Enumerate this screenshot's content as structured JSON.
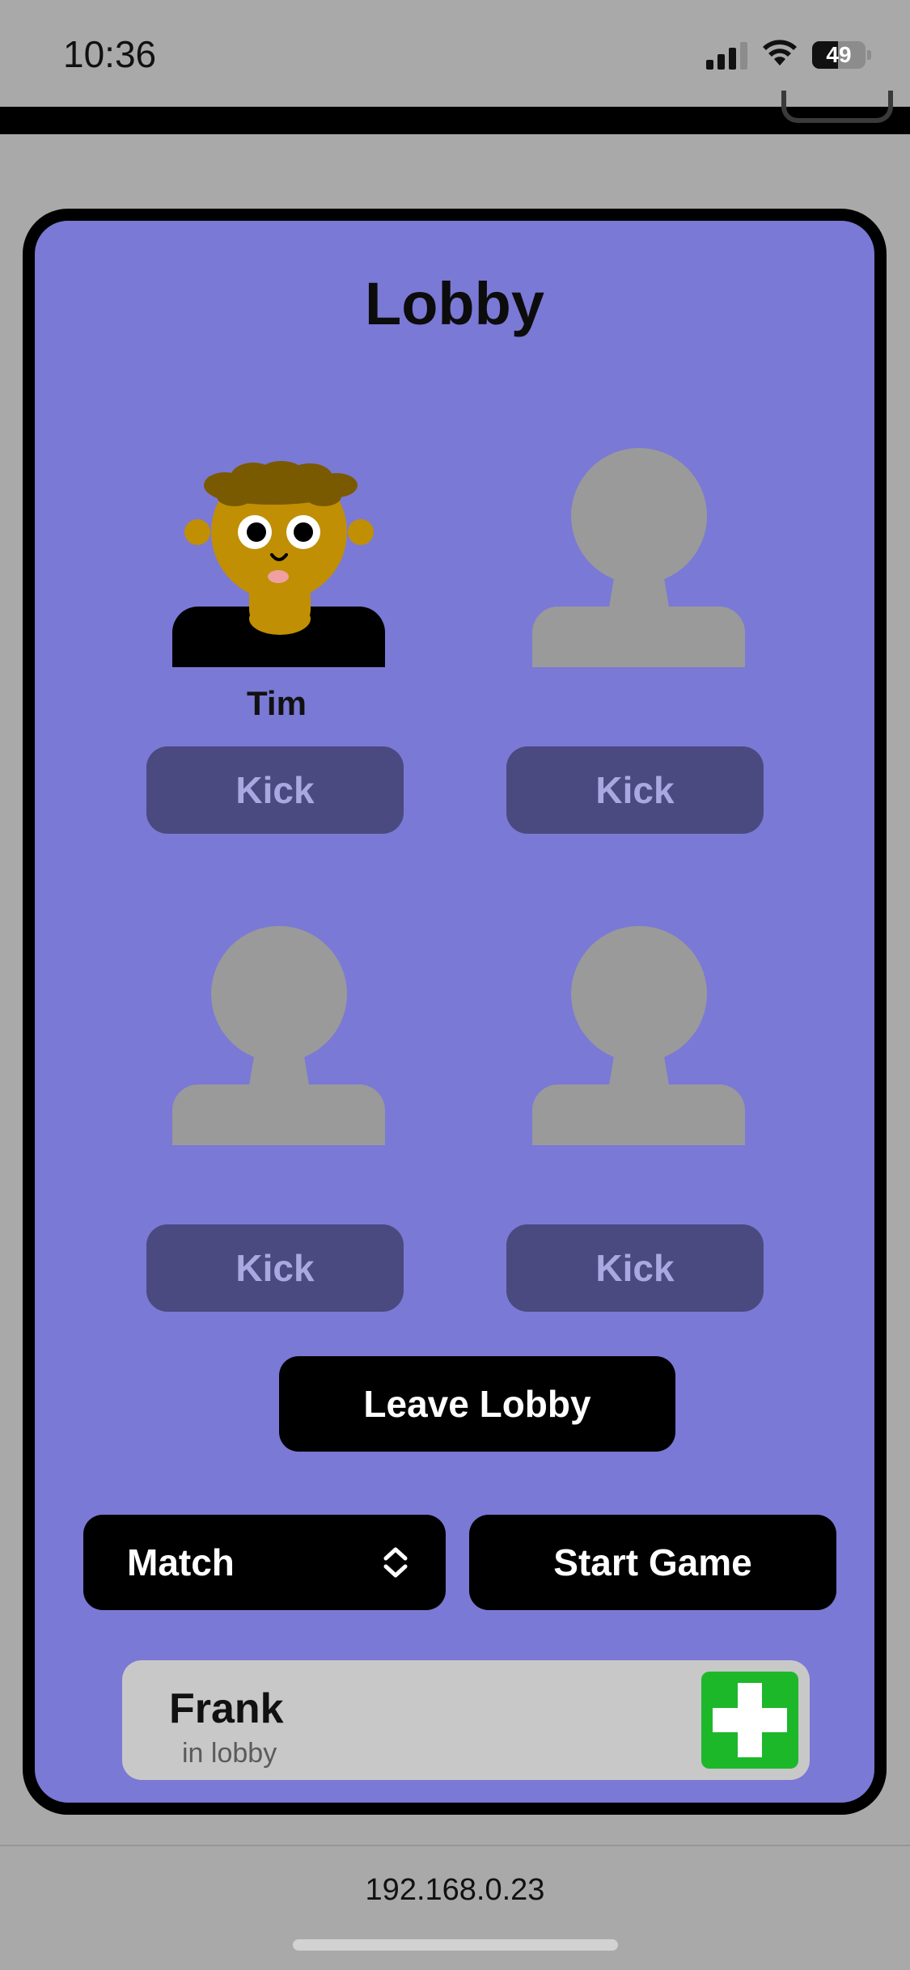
{
  "status_bar": {
    "time": "10:36",
    "battery": "49",
    "battery_level": 0.49
  },
  "lobby": {
    "title": "Lobby",
    "slots": [
      {
        "name": "Tim",
        "occupied": true,
        "kick_label": "Kick"
      },
      {
        "name": "",
        "occupied": false,
        "kick_label": "Kick"
      },
      {
        "name": "",
        "occupied": false,
        "kick_label": "Kick"
      },
      {
        "name": "",
        "occupied": false,
        "kick_label": "Kick"
      }
    ],
    "leave_label": "Leave Lobby",
    "mode_select": {
      "selected": "Match"
    },
    "start_label": "Start Game",
    "invite": {
      "name": "Frank",
      "status": "in lobby"
    }
  },
  "footer": {
    "ip": "192.168.0.23"
  },
  "colors": {
    "card_bg": "#7a79d5",
    "kick_bg": "#4a4a80",
    "kick_text": "#a9a8e0",
    "add_green": "#1cb82a",
    "placeholder_gray": "#9a9a9a"
  }
}
